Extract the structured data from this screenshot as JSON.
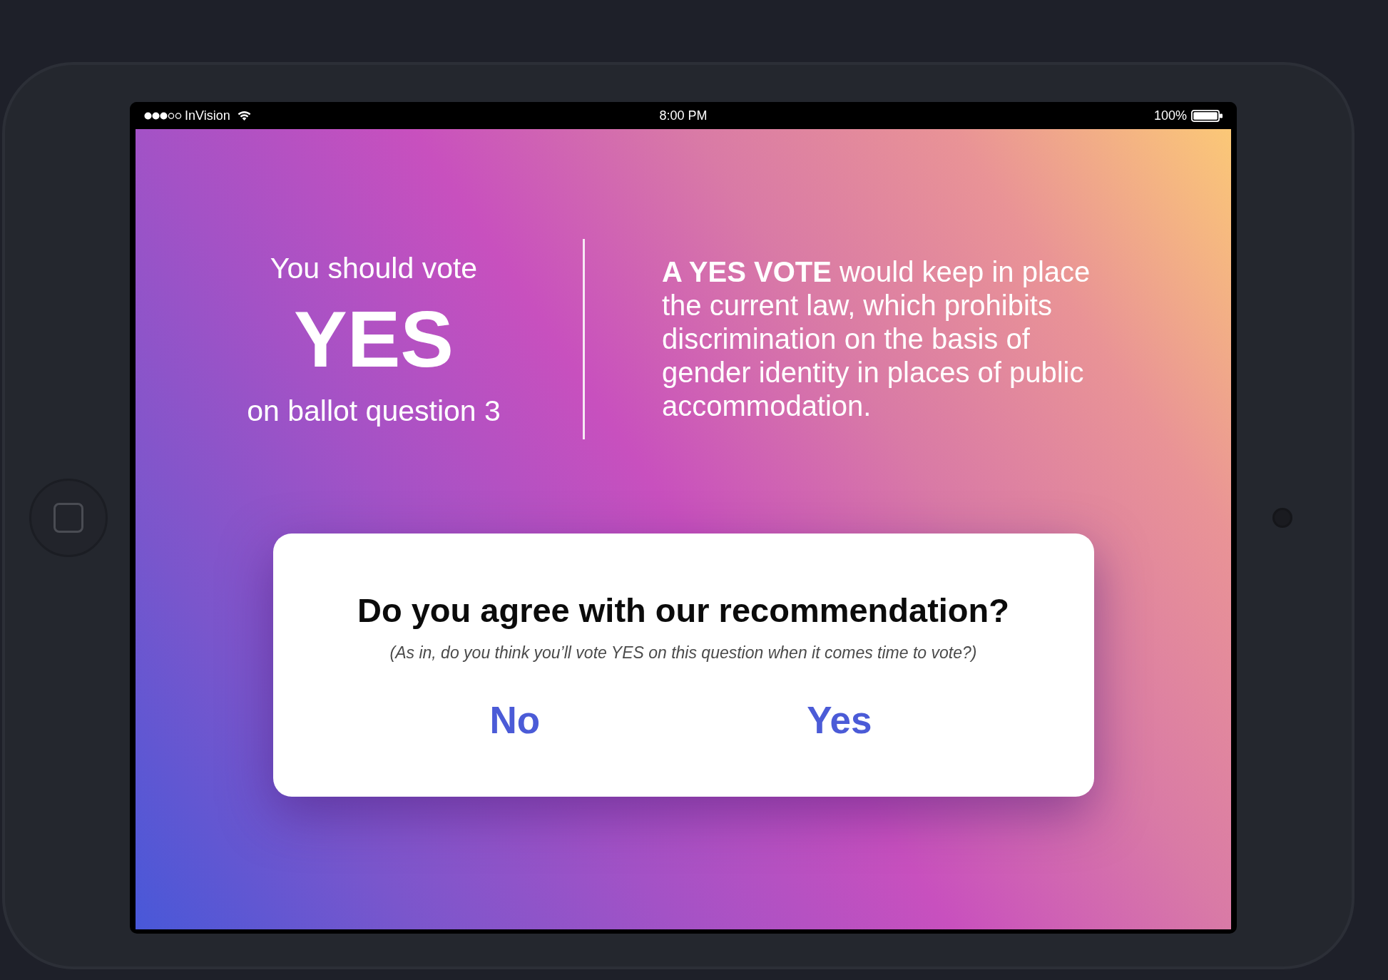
{
  "status_bar": {
    "carrier": "InVision",
    "time": "8:00 PM",
    "battery": "100%"
  },
  "recommendation": {
    "intro": "You should vote",
    "vote": "YES",
    "ballot": "on ballot question 3"
  },
  "explanation": "**A YES VOTE** would keep in place the current law, which prohibits discrimination on the basis of gender identity in places of public accommodation.",
  "dialog": {
    "title": "Do you agree with our recommendation?",
    "subtitle": "(As in, do you think you’ll vote YES on this question when it comes time to vote?)",
    "buttons": [
      "No",
      "Yes"
    ]
  }
}
